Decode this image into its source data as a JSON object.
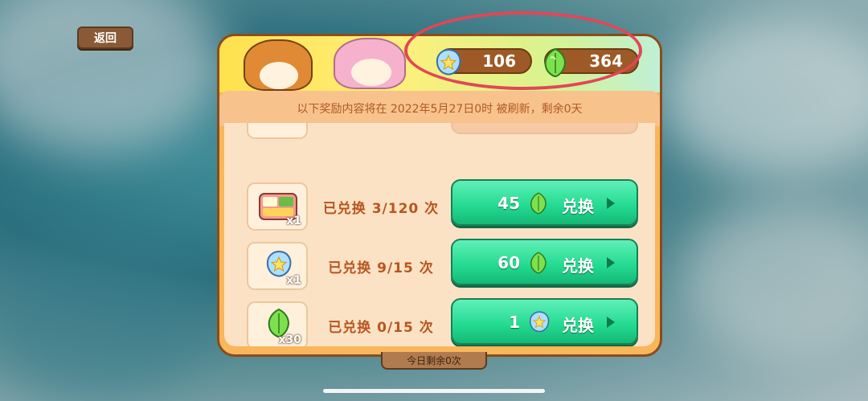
{
  "nav": {
    "back_label": "返回"
  },
  "currencies": [
    {
      "icon": "blue-crystal-icon",
      "amount": "106"
    },
    {
      "icon": "green-leaf-gem-icon",
      "amount": "364"
    }
  ],
  "notice": "以下奖励内容将在 2022年5月27日0时 被刷新，剩余0天",
  "exchange_label": "兑换",
  "items": [
    {
      "icon": "lunchbox-icon",
      "qty": "x1",
      "status": "已兑换  3/120  次",
      "cost": "45",
      "cost_icon": "green-leaf-gem-icon"
    },
    {
      "icon": "blue-crystal-icon",
      "qty": "x1",
      "status": "已兑换  9/15  次",
      "cost": "60",
      "cost_icon": "green-leaf-gem-icon"
    },
    {
      "icon": "green-leaf-gem-icon",
      "qty": "x30",
      "status": "已兑换  0/15  次",
      "cost": "1",
      "cost_icon": "blue-crystal-icon"
    }
  ],
  "bottom_tab": "今日剩余0次",
  "colors": {
    "accent_green": "#22d98f",
    "panel_orange": "#f9b65a",
    "highlight_red": "#e24657",
    "text_brown": "#b8551f"
  }
}
